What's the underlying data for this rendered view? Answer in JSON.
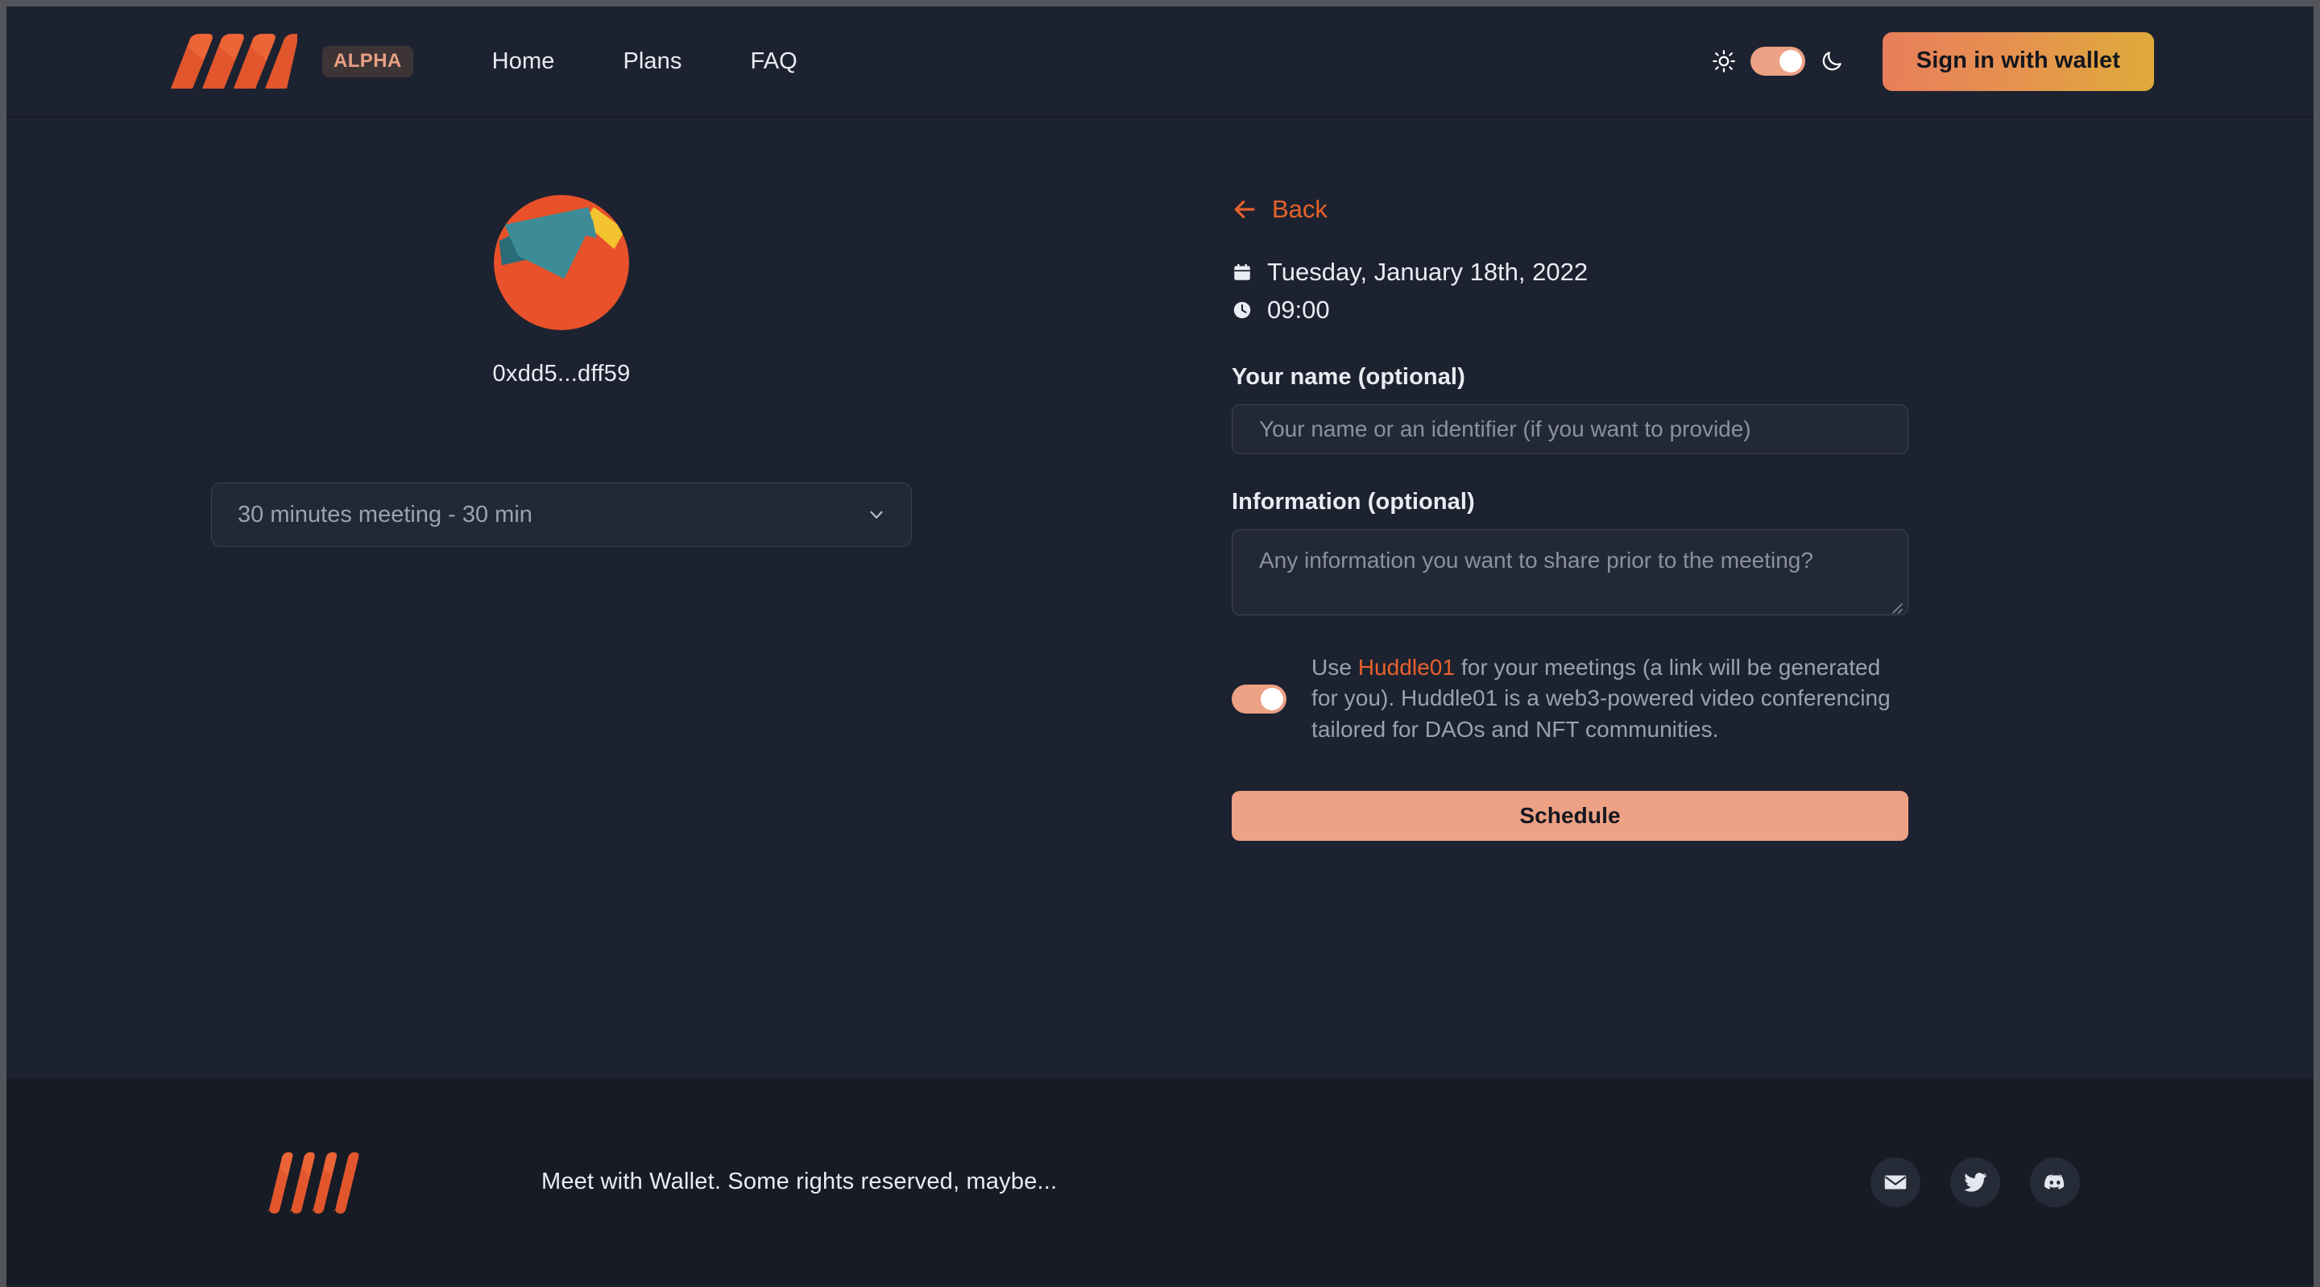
{
  "colors": {
    "page_bg": "#1d2230",
    "footer_bg": "#171b26",
    "accent_orange": "#e8622c",
    "accent_salmon": "#eda185",
    "text_primary": "#e9ecf2",
    "text_muted": "#9aa1af",
    "badge_bg": "#3d3436",
    "badge_text": "#e8a084",
    "signin_gradient_from": "#e87e5b",
    "signin_gradient_to": "#dfab3a",
    "avatar_orange": "#e8512a",
    "avatar_teal": "#3d8b96",
    "avatar_teal_dark": "#2c6b78",
    "avatar_yellow": "#f4c430"
  },
  "header": {
    "logo_name": "meet-with-wallet-logo",
    "badge": "ALPHA",
    "nav": [
      {
        "label": "Home",
        "name": "nav-link-home"
      },
      {
        "label": "Plans",
        "name": "nav-link-plans"
      },
      {
        "label": "FAQ",
        "name": "nav-link-faq"
      }
    ],
    "theme_toggle": {
      "light_icon": "sun-icon",
      "dark_icon": "moon-icon",
      "state": "dark"
    },
    "signin_label": "Sign in with wallet"
  },
  "left": {
    "avatar_name": "wallet-identicon-avatar",
    "wallet_address": "0xdd5...dff59",
    "duration": {
      "selected": "30 minutes meeting - 30 min",
      "chevron": "chevron-down-icon"
    }
  },
  "right": {
    "back_label": "Back",
    "back_icon": "arrow-left-icon",
    "date_icon": "calendar-icon",
    "date": "Tuesday, January 18th, 2022",
    "time_icon": "clock-icon",
    "time": "09:00",
    "name_field": {
      "label": "Your name (optional)",
      "value": "",
      "placeholder": "Your name or an identifier (if you want to provide)"
    },
    "info_field": {
      "label": "Information (optional)",
      "value": "",
      "placeholder": "Any information you want to share prior to the meeting?"
    },
    "huddle": {
      "enabled": true,
      "text_before": "Use ",
      "link_label": "Huddle01",
      "text_after": " for your meetings (a link will be generated for you). Huddle01 is a web3-powered video conferencing tailored for DAOs and NFT communities."
    },
    "schedule_label": "Schedule"
  },
  "footer": {
    "logo_name": "meet-with-wallet-logo-footer",
    "copy": "Meet with Wallet. Some rights reserved, maybe...",
    "socials": [
      {
        "name": "email-icon",
        "label": "Email"
      },
      {
        "name": "twitter-icon",
        "label": "Twitter"
      },
      {
        "name": "discord-icon",
        "label": "Discord"
      }
    ]
  }
}
